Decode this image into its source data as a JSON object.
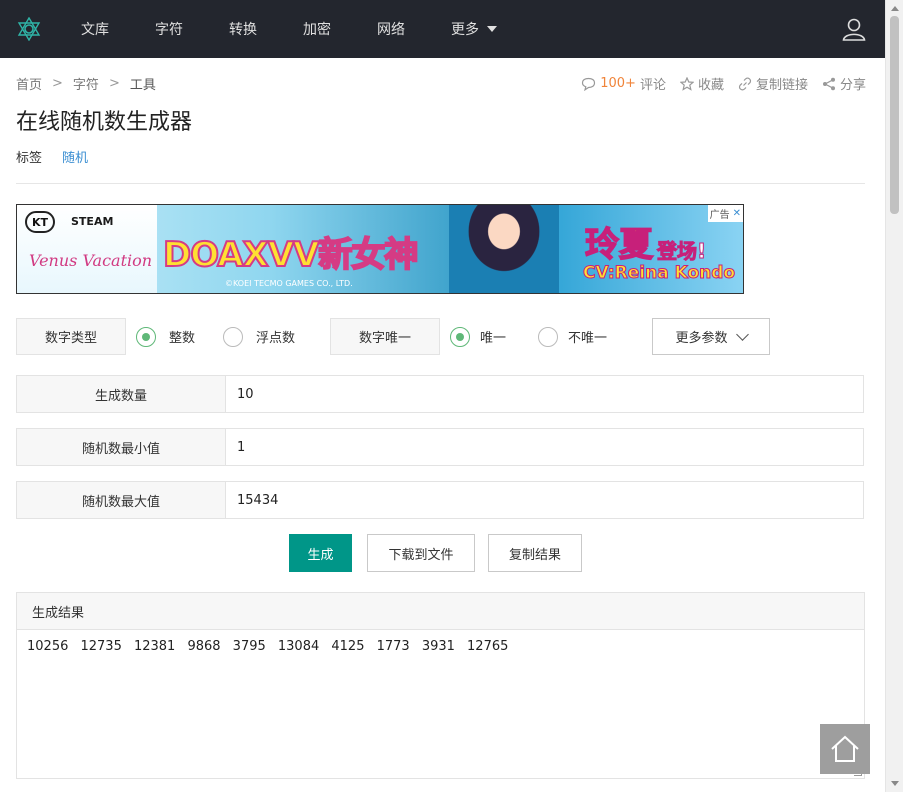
{
  "nav": {
    "items": [
      "文库",
      "字符",
      "转换",
      "加密",
      "网络"
    ],
    "more_label": "更多"
  },
  "breadcrumb": [
    "首页",
    "字符",
    "工具"
  ],
  "actions": {
    "comment_count": "100+",
    "comment_label": "评论",
    "favorite_label": "收藏",
    "copy_link_label": "复制链接",
    "share_label": "分享"
  },
  "page": {
    "title": "在线随机数生成器",
    "tag_label": "标签",
    "tags": [
      "随机"
    ]
  },
  "ad": {
    "kt": "KT",
    "steam": "STEAM",
    "venus": "Venus Vacation",
    "headline": "DOAXVV新女神",
    "copyright": "©KOEI TECMO GAMES CO., LTD.",
    "right_title": "玲夏",
    "right_sub": "登场!",
    "cv": "CV:Reina Kondo",
    "badge": "广告"
  },
  "options": {
    "type_label": "数字类型",
    "type_options": [
      "整数",
      "浮点数"
    ],
    "type_selected": "整数",
    "unique_label": "数字唯一",
    "unique_options": [
      "唯一",
      "不唯一"
    ],
    "unique_selected": "唯一",
    "more_params": "更多参数"
  },
  "fields": {
    "count_label": "生成数量",
    "count_value": "10",
    "min_label": "随机数最小值",
    "min_value": "1",
    "max_label": "随机数最大值",
    "max_value": "15434"
  },
  "buttons": {
    "generate": "生成",
    "download": "下载到文件",
    "copy": "复制结果"
  },
  "result": {
    "label": "生成结果",
    "text": "10256 12735 12381 9868 3795 13084 4125 1773 3931 12765"
  },
  "colors": {
    "nav_bg": "#23262e",
    "primary": "#009688",
    "radio_on": "#5fb878",
    "tag_link": "#3a8ed2",
    "count_accent": "#f0843a"
  }
}
